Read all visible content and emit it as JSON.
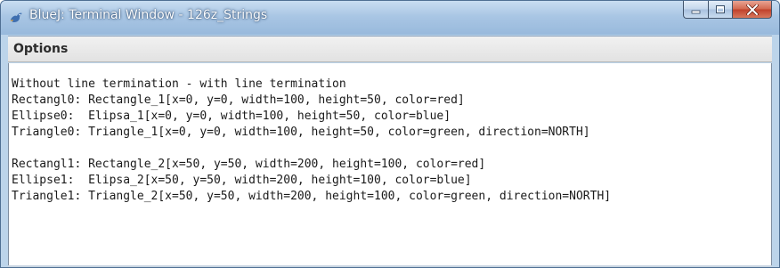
{
  "window": {
    "title": "BlueJ: Terminal Window - 126z_Strings",
    "app_icon": "bluej-bird-icon",
    "controls": {
      "minimize_icon": "minimize-icon",
      "maximize_icon": "maximize-icon",
      "close_icon": "close-icon"
    }
  },
  "menubar": {
    "options_label": "Options"
  },
  "terminal": {
    "lines": [
      "Without line termination - with line termination",
      "Rectangl0: Rectangle_1[x=0, y=0, width=100, height=50, color=red]",
      "Ellipse0:  Elipsa_1[x=0, y=0, width=100, height=50, color=blue]",
      "Triangle0: Triangle_1[x=0, y=0, width=100, height=50, color=green, direction=NORTH]",
      "",
      "Rectangl1: Rectangle_2[x=50, y=50, width=200, height=100, color=red]",
      "Ellipse1:  Elipsa_2[x=50, y=50, width=200, height=100, color=blue]",
      "Triangle1: Triangle_2[x=50, y=50, width=200, height=100, color=green, direction=NORTH]"
    ]
  },
  "colors": {
    "title_bar": "#a9c6e4",
    "close_button": "#c94a33"
  }
}
